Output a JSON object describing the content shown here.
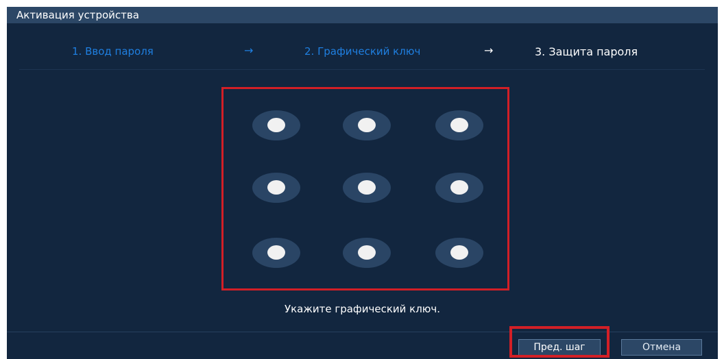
{
  "window": {
    "title": "Активация устройства"
  },
  "steps": [
    {
      "label": "1.  Ввод пароля"
    },
    {
      "label": "2.  Графический ключ"
    },
    {
      "label": "3.  Защита пароля"
    }
  ],
  "arrows": [
    "→",
    "→"
  ],
  "pattern": {
    "rows": 3,
    "cols": 3,
    "hint": "Укажите графический ключ."
  },
  "buttons": {
    "prev_label": "Пред. шаг",
    "cancel_label": "Отмена"
  },
  "colors": {
    "background": "#12263f",
    "titlebar": "#2c4766",
    "accent": "#1f7fe0",
    "highlight": "#d21f26"
  }
}
